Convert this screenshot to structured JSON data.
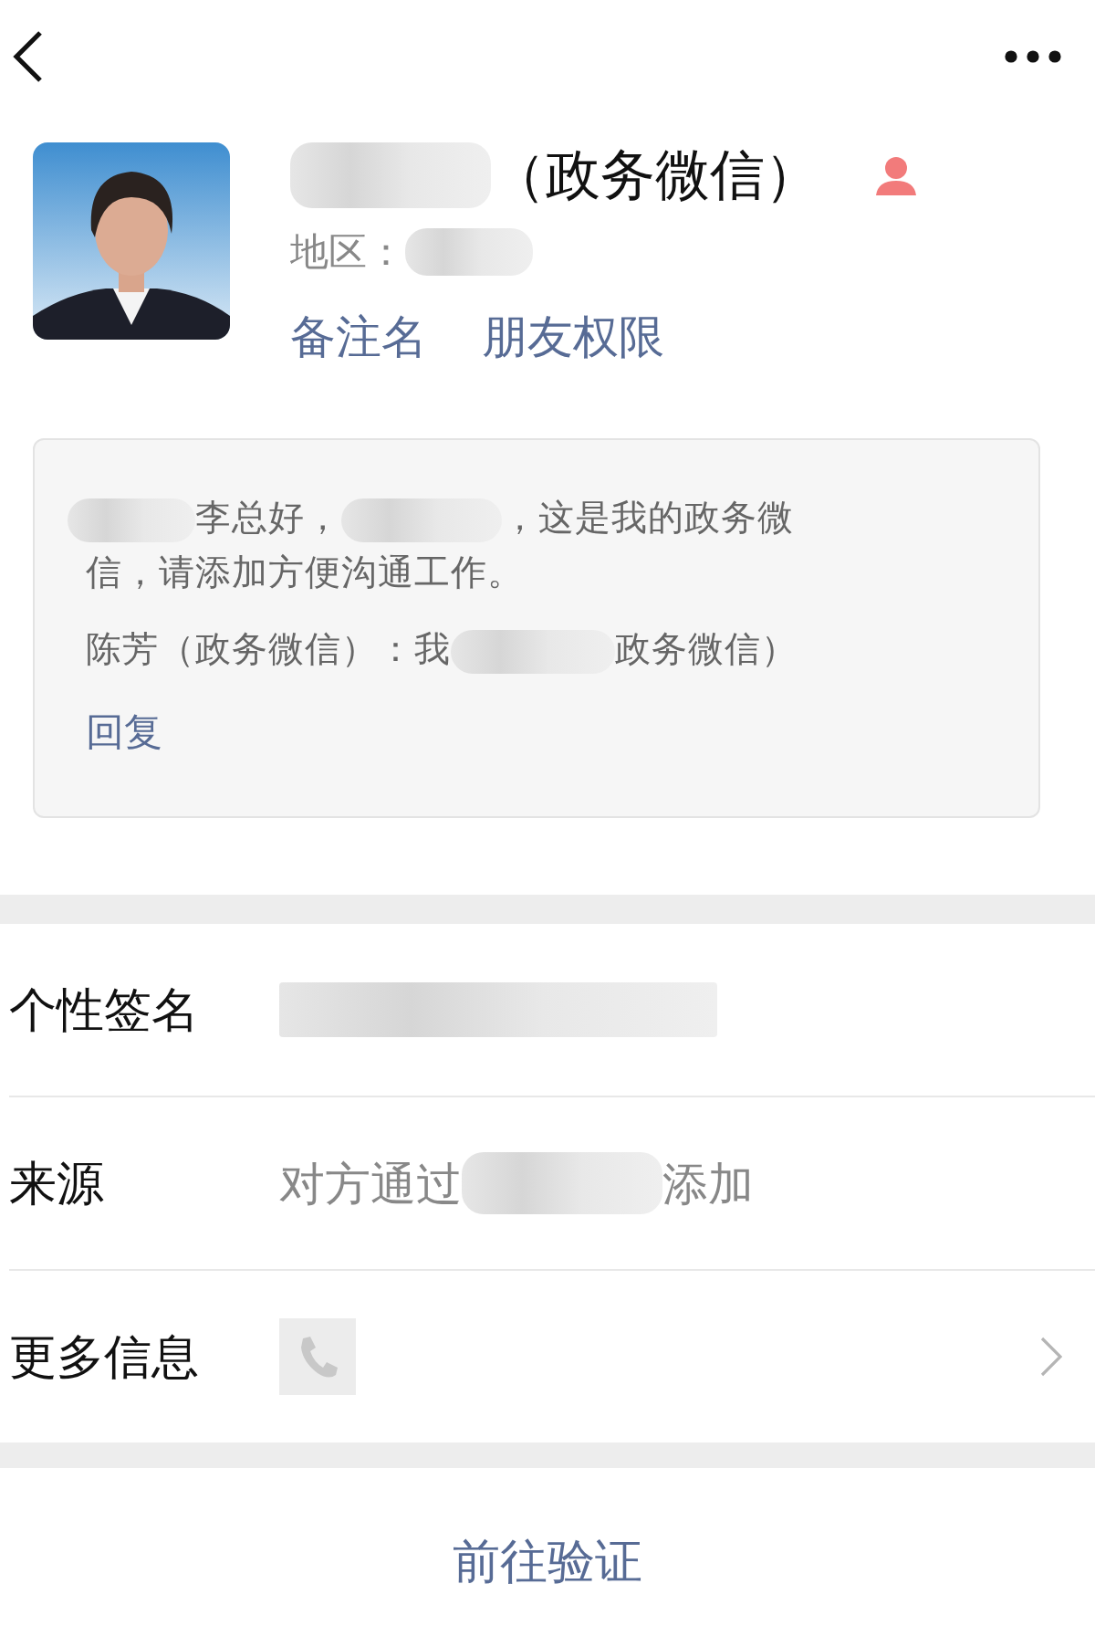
{
  "profile": {
    "name": "（政务微信）",
    "region_label": "地区：",
    "links": [
      "备注名",
      "朋友权限"
    ]
  },
  "greeting": {
    "line_start": "李总好，",
    "line_rest": "，这是我的政务微",
    "line_2": "信，请添加方便沟通工作。",
    "reply_prefix": "陈芳（政务微信）：我",
    "reply_suffix": "政务微信）",
    "reply_action": "回复"
  },
  "rows": [
    {
      "label": "个性签名",
      "kind": "blurred"
    },
    {
      "label": "来源",
      "kind": "text",
      "before": "对方通过",
      "after": "添加"
    },
    {
      "label": "更多信息",
      "kind": "phone"
    }
  ],
  "action": "前往验证"
}
